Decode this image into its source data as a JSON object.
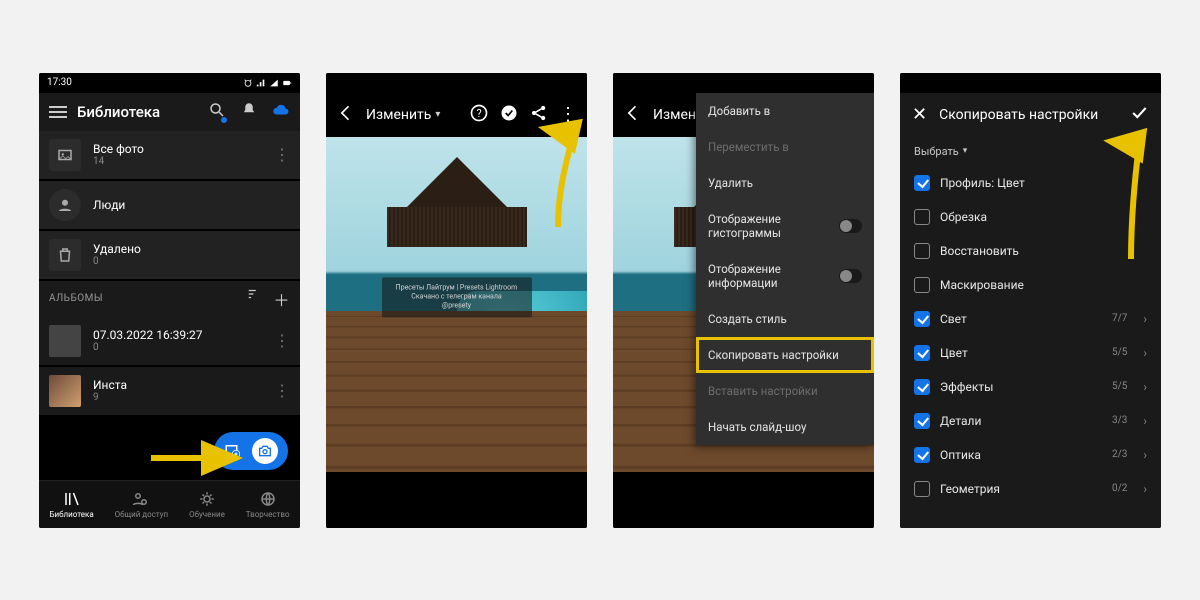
{
  "status": {
    "time": "17:30"
  },
  "screen1": {
    "title": "Библиотека",
    "all_photos": {
      "label": "Все фото",
      "count": "14"
    },
    "people": {
      "label": "Люди"
    },
    "deleted": {
      "label": "Удалено",
      "count": "0"
    },
    "section": "АЛЬБОМЫ",
    "album1": {
      "label": "07.03.2022 16:39:27",
      "count": "0"
    },
    "album2": {
      "label": "Инста",
      "count": "9"
    },
    "tabs": {
      "library": "Библиотека",
      "shared": "Общий доступ",
      "learn": "Обучение",
      "discover": "Творчество"
    }
  },
  "screen2": {
    "title": "Изменить",
    "watermark": "Пресеты Лайтрум | Presets Lightroom\nСкачано с телеграм канала\n@presety"
  },
  "screen3": {
    "title": "Измени",
    "menu": {
      "add_to": "Добавить в",
      "move_to": "Переместить в",
      "delete": "Удалить",
      "histogram": "Отображение гистограммы",
      "info": "Отображение информации",
      "create_style": "Создать стиль",
      "copy": "Скопировать настройки",
      "paste": "Вставить настройки",
      "slideshow": "Начать слайд-шоу"
    }
  },
  "screen4": {
    "title": "Скопировать настройки",
    "select": "Выбрать",
    "options": {
      "profile": {
        "label": "Профиль: Цвет",
        "checked": true
      },
      "crop": {
        "label": "Обрезка",
        "checked": false
      },
      "restore": {
        "label": "Восстановить",
        "checked": false
      },
      "mask": {
        "label": "Маскирование",
        "checked": false
      },
      "light": {
        "label": "Свет",
        "checked": true,
        "count": "7/7"
      },
      "color": {
        "label": "Цвет",
        "checked": true,
        "count": "5/5"
      },
      "effects": {
        "label": "Эффекты",
        "checked": true,
        "count": "5/5"
      },
      "detail": {
        "label": "Детали",
        "checked": true,
        "count": "3/3"
      },
      "optics": {
        "label": "Оптика",
        "checked": true,
        "count": "2/3"
      },
      "geometry": {
        "label": "Геометрия",
        "checked": false,
        "count": "0/2"
      }
    }
  }
}
